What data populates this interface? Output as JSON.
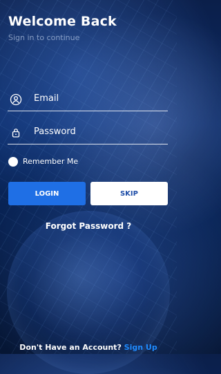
{
  "header": {
    "title": "Welcome Back",
    "subtitle": "Sign in to continue"
  },
  "form": {
    "email_label": "Email",
    "password_label": "Password",
    "remember_label": "Remember Me"
  },
  "buttons": {
    "login_label": "LOGIN",
    "skip_label": "SKIP"
  },
  "links": {
    "forgot_password": "Forgot Password ?",
    "no_account_text": "Don't Have an Account?",
    "signup_label": "Sign Up"
  },
  "colors": {
    "primary": "#1f6fe5",
    "signup": "#1f8bff",
    "background": "#0a2a66"
  },
  "icons": {
    "email": "user-circle-icon",
    "password": "lock-icon"
  }
}
